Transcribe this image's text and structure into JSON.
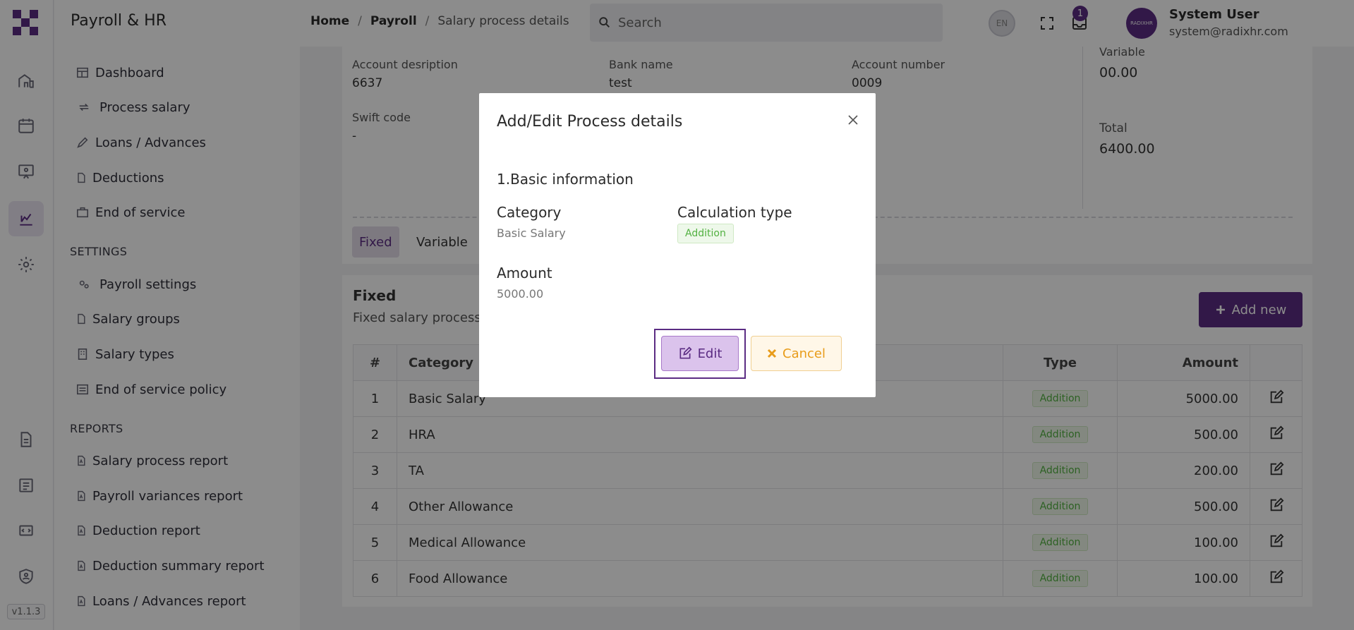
{
  "app": {
    "title": "Payroll & HR",
    "version": "v1.1.3"
  },
  "sidebar": {
    "items": [
      {
        "label": "Dashboard",
        "icon": "table-icon"
      },
      {
        "label": "Process salary",
        "icon": "repeat-icon"
      },
      {
        "label": "Loans / Advances",
        "icon": "pencil-icon"
      },
      {
        "label": "Deductions",
        "icon": "file-icon"
      },
      {
        "label": "End of service",
        "icon": "briefcase-icon"
      }
    ],
    "settings_heading": "SETTINGS",
    "settings": [
      {
        "label": "Payroll settings",
        "icon": "gears-icon"
      },
      {
        "label": "Salary groups",
        "icon": "file-icon"
      },
      {
        "label": "Salary types",
        "icon": "building-icon"
      },
      {
        "label": "End of service policy",
        "icon": "list-icon"
      }
    ],
    "reports_heading": "REPORTS",
    "reports": [
      {
        "label": "Salary process report",
        "icon": "pdf-icon"
      },
      {
        "label": "Payroll variances report",
        "icon": "pdf-icon"
      },
      {
        "label": "Deduction report",
        "icon": "pdf-icon"
      },
      {
        "label": "Deduction summary report",
        "icon": "pdf-icon"
      },
      {
        "label": "Loans / Advances report",
        "icon": "pdf-icon"
      }
    ]
  },
  "breadcrumb": {
    "home": "Home",
    "payroll": "Payroll",
    "current": "Salary process details",
    "sep": "/"
  },
  "search": {
    "placeholder": "Search"
  },
  "header": {
    "lang": "EN",
    "notif_count": "1",
    "user_name": "System User",
    "user_email": "system@radixhr.com",
    "avatar_text": "RADIXHR"
  },
  "account": {
    "desc_label": "Account desription",
    "desc_value": "6637",
    "bank_label": "Bank name",
    "bank_value": "test",
    "number_label": "Account number",
    "number_value": "0009",
    "swift_label": "Swift code",
    "swift_value": "-",
    "variable_label": "Variable",
    "variable_value": "00.00",
    "total_label": "Total",
    "total_value": "6400.00"
  },
  "tabs": {
    "fixed": "Fixed",
    "variable": "Variable"
  },
  "fixed": {
    "title": "Fixed",
    "subtitle": "Fixed salary process details",
    "add_button": "Add new"
  },
  "table": {
    "headers": {
      "num": "#",
      "category": "Category",
      "type": "Type",
      "amount": "Amount"
    },
    "rows": [
      {
        "num": "1",
        "category": "Basic Salary",
        "type": "Addition",
        "amount": "5000.00"
      },
      {
        "num": "2",
        "category": "HRA",
        "type": "Addition",
        "amount": "500.00"
      },
      {
        "num": "3",
        "category": "TA",
        "type": "Addition",
        "amount": "200.00"
      },
      {
        "num": "4",
        "category": "Other Allowance",
        "type": "Addition",
        "amount": "500.00"
      },
      {
        "num": "5",
        "category": "Medical Allowance",
        "type": "Addition",
        "amount": "100.00"
      },
      {
        "num": "6",
        "category": "Food Allowance",
        "type": "Addition",
        "amount": "100.00"
      }
    ]
  },
  "modal": {
    "title": "Add/Edit Process details",
    "section": "1.Basic information",
    "category_label": "Category",
    "category_value": "Basic Salary",
    "calc_label": "Calculation type",
    "calc_value": "Addition",
    "amount_label": "Amount",
    "amount_value": "5000.00",
    "edit_button": "Edit",
    "cancel_button": "Cancel"
  },
  "colors": {
    "brand": "#5b2c83",
    "addition_green": "#52b141",
    "cancel_orange": "#e89c1a"
  }
}
